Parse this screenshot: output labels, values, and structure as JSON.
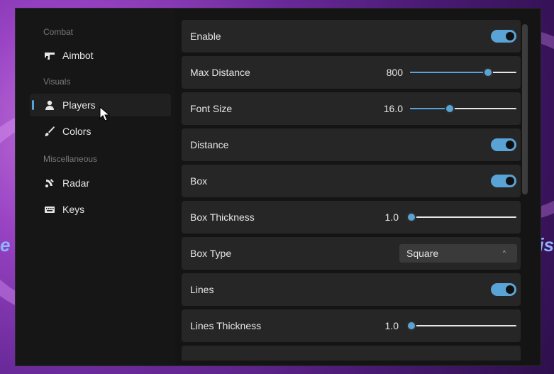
{
  "sidebar": {
    "sections": [
      {
        "title": "Combat",
        "items": [
          {
            "label": "Aimbot",
            "icon": "gun-icon"
          }
        ]
      },
      {
        "title": "Visuals",
        "items": [
          {
            "label": "Players",
            "icon": "user-icon"
          },
          {
            "label": "Colors",
            "icon": "brush-icon"
          }
        ]
      },
      {
        "title": "Miscellaneous",
        "items": [
          {
            "label": "Radar",
            "icon": "radar-icon"
          },
          {
            "label": "Keys",
            "icon": "keyboard-icon"
          }
        ]
      }
    ],
    "active_item": "Players"
  },
  "settings": [
    {
      "label": "Enable",
      "type": "toggle",
      "on": true
    },
    {
      "label": "Max Distance",
      "type": "slider",
      "value_text": "800",
      "fraction": 0.73
    },
    {
      "label": "Font Size",
      "type": "slider",
      "value_text": "16.0",
      "fraction": 0.37
    },
    {
      "label": "Distance",
      "type": "toggle",
      "on": true
    },
    {
      "label": "Box",
      "type": "toggle",
      "on": true
    },
    {
      "label": "Box Thickness",
      "type": "slider",
      "value_text": "1.0",
      "fraction": 0.0
    },
    {
      "label": "Box Type",
      "type": "dropdown",
      "value": "Square",
      "caret": "^"
    },
    {
      "label": "Lines",
      "type": "toggle",
      "on": true
    },
    {
      "label": "Lines Thickness",
      "type": "slider",
      "value_text": "1.0",
      "fraction": 0.0
    }
  ],
  "background": {
    "text_left": "e",
    "text_right": "is"
  },
  "colors": {
    "accent": "#5aa3d6",
    "row_bg": "#262626",
    "window_bg": "#141414"
  }
}
